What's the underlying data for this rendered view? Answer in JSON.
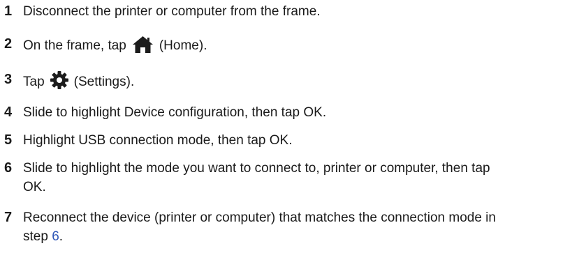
{
  "steps": [
    {
      "number": "1",
      "text": "Disconnect the printer or computer from the frame."
    },
    {
      "number": "2",
      "before": "On the frame, tap",
      "icon": "home-icon",
      "after": "(Home)."
    },
    {
      "number": "3",
      "before": "Tap",
      "icon": "gear-icon",
      "after": "(Settings)."
    },
    {
      "number": "4",
      "text": "Slide to highlight Device configuration, then tap OK."
    },
    {
      "number": "5",
      "text": "Highlight USB connection mode, then tap OK."
    },
    {
      "number": "6",
      "line1": "Slide to highlight the mode you want to connect to, printer or computer, then tap",
      "line2": "OK."
    },
    {
      "number": "7",
      "line1": "Reconnect the device (printer or computer) that matches the connection mode in",
      "line2_before": "step",
      "link": "6",
      "line2_after": "."
    }
  ],
  "colors": {
    "text": "#1a1a1a",
    "link": "#2f57b8",
    "icon": "#1c1c1c"
  }
}
